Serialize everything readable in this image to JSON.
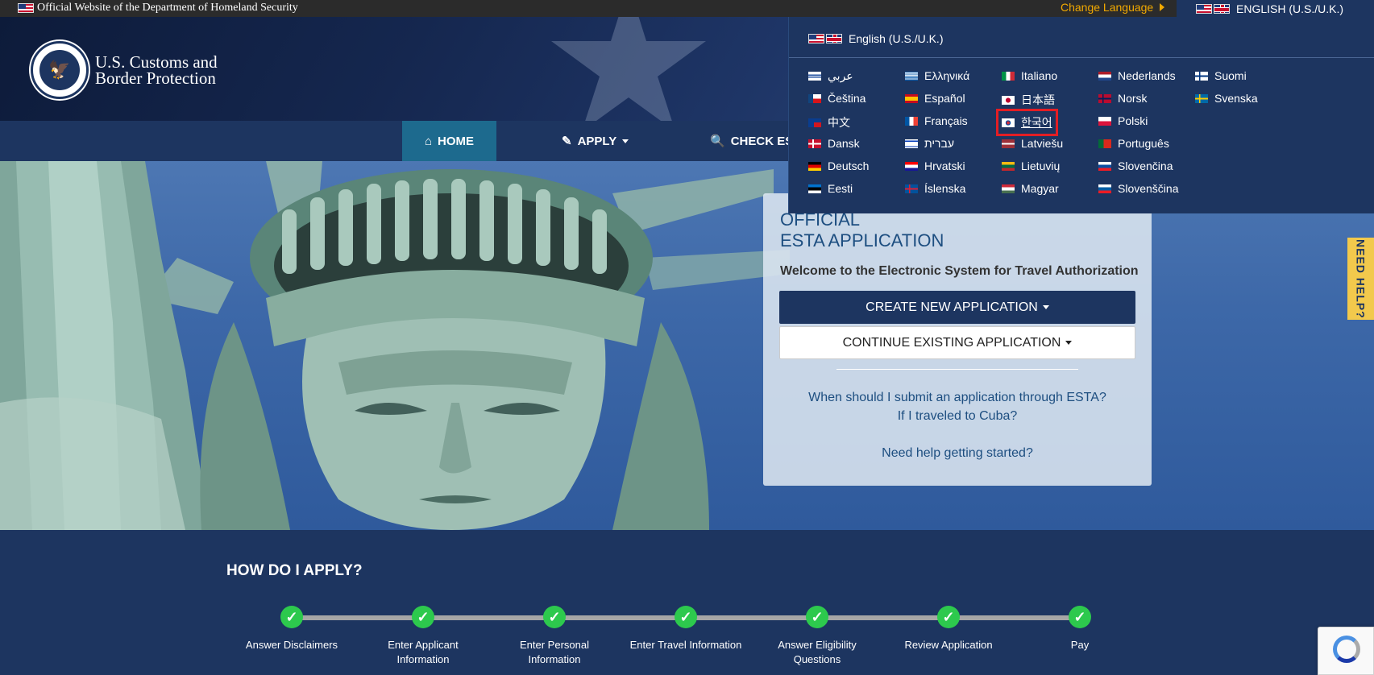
{
  "govbar": {
    "official_text": "Official Website of the Department of Homeland Security",
    "change_language": "Change Language",
    "current_language": "ENGLISH (U.S./U.K.)"
  },
  "header": {
    "agency_line1": "U.S. Customs and",
    "agency_line2": "Border Protection"
  },
  "nav": {
    "home": "HOME",
    "apply": "APPLY",
    "check": "CHECK EST"
  },
  "language_menu": {
    "current": "English (U.S./U.K.)",
    "languages": [
      {
        "label": "عربي",
        "flag": "il-like"
      },
      {
        "label": "Čeština",
        "flag": "cz"
      },
      {
        "label": "中文",
        "flag": "tw"
      },
      {
        "label": "Dansk",
        "flag": "dk"
      },
      {
        "label": "Deutsch",
        "flag": "de"
      },
      {
        "label": "Eesti",
        "flag": "ee"
      },
      {
        "label": "Ελληνικά",
        "flag": "gr"
      },
      {
        "label": "Español",
        "flag": "es"
      },
      {
        "label": "Français",
        "flag": "fr"
      },
      {
        "label": "עברית",
        "flag": "il"
      },
      {
        "label": "Hrvatski",
        "flag": "hr"
      },
      {
        "label": "Íslenska",
        "flag": "is"
      },
      {
        "label": "Italiano",
        "flag": "it"
      },
      {
        "label": "日本語",
        "flag": "jp"
      },
      {
        "label": "한국어",
        "flag": "kr"
      },
      {
        "label": "Latviešu",
        "flag": "lv"
      },
      {
        "label": "Lietuvių",
        "flag": "lt"
      },
      {
        "label": "Magyar",
        "flag": "hu"
      },
      {
        "label": "Nederlands",
        "flag": "nl"
      },
      {
        "label": "Norsk",
        "flag": "no"
      },
      {
        "label": "Polski",
        "flag": "pl"
      },
      {
        "label": "Português",
        "flag": "pt"
      },
      {
        "label": "Slovenčina",
        "flag": "sk"
      },
      {
        "label": "Slovenščina",
        "flag": "si"
      },
      {
        "label": "Suomi",
        "flag": "fi"
      },
      {
        "label": "Svenska",
        "flag": "se"
      }
    ]
  },
  "esta": {
    "official_line1": "OFFICIAL",
    "official_line2": "ESTA APPLICATION",
    "welcome": "Welcome to the Electronic System for Travel Authorization",
    "create_button": "CREATE NEW APPLICATION",
    "continue_button": "CONTINUE EXISTING APPLICATION",
    "question1": "When should I submit an application through ESTA?",
    "question2": "If I traveled to Cuba?",
    "question3": "Need help getting started?"
  },
  "how": {
    "title": "HOW DO I APPLY?",
    "steps": [
      {
        "line1": "Answer Disclaimers",
        "line2": ""
      },
      {
        "line1": "Enter Applicant",
        "line2": "Information"
      },
      {
        "line1": "Enter Personal",
        "line2": "Information"
      },
      {
        "line1": "Enter Travel Information",
        "line2": ""
      },
      {
        "line1": "Answer Eligibility",
        "line2": "Questions"
      },
      {
        "line1": "Review Application",
        "line2": ""
      },
      {
        "line1": "Pay",
        "line2": ""
      }
    ]
  },
  "need_help": "NEED HELP?",
  "colors": {
    "navy": "#1d3560",
    "accent_gold": "#f2a900",
    "home_tab": "#1d6a8e",
    "step_check": "#2dc94d",
    "highlight": "#e31e24"
  }
}
